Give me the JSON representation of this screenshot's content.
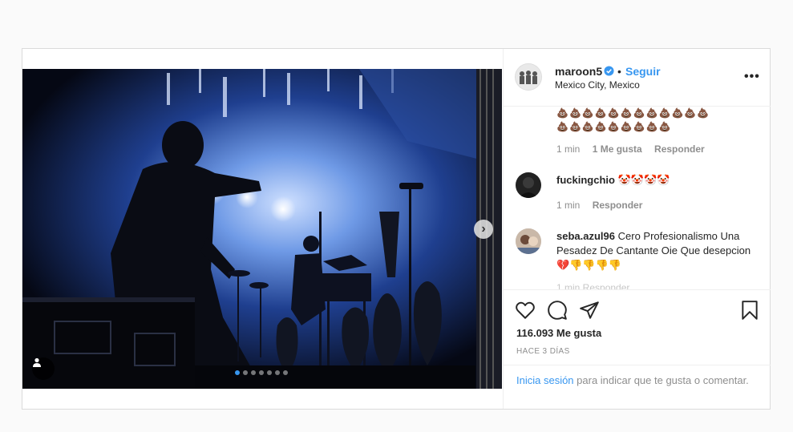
{
  "post": {
    "username": "maroon5",
    "separator": "•",
    "follow_label": "Seguir",
    "location": "Mexico City, Mexico",
    "more_label": "•••"
  },
  "carousel": {
    "total_slides": 7,
    "active_index": 0,
    "next_label": "›"
  },
  "comments": [
    {
      "emoji_line1": "💩💩💩💩💩💩💩💩💩💩💩💩",
      "emoji_line2": "💩💩💩💩💩💩💩💩💩",
      "time": "1 min",
      "likes": "1 Me gusta",
      "reply": "Responder"
    },
    {
      "username": "fuckingchio",
      "text": "🤡🤡🤡🤡",
      "time": "1 min",
      "reply": "Responder"
    },
    {
      "username": "seba.azul96",
      "text": "Cero Profesionalismo Una Pesadez De Cantante Oie Que desepcion 💔👎👎👎👎",
      "faded": "1 min Responder"
    }
  ],
  "actions": {
    "like_count": "116.093 Me gusta",
    "timestamp": "HACE 3 DÍAS"
  },
  "login_prompt": {
    "link": "Inicia sesión",
    "rest": " para indicar que te gusta o comentar."
  },
  "colors": {
    "accent": "#3897f0",
    "muted": "#8e8e8e",
    "border": "#dbdbdb"
  }
}
